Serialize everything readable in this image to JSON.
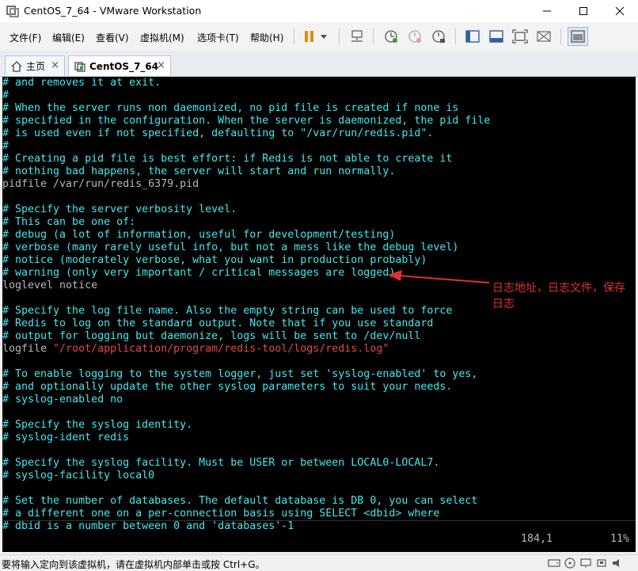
{
  "window": {
    "title": "CentOS_7_64 - VMware Workstation"
  },
  "menu": [
    "文件(F)",
    "编辑(E)",
    "查看(V)",
    "虚拟机(M)",
    "选项卡(T)",
    "帮助(H)"
  ],
  "tabs": {
    "home_label": "主页",
    "vm_label": "CentOS_7_64",
    "close_glyph": "×"
  },
  "terminal": {
    "lines": [
      {
        "t": "# and removes it at exit.",
        "c": "blue"
      },
      {
        "t": "#",
        "c": "blue"
      },
      {
        "t": "# When the server runs non daemonized, no pid file is created if none is",
        "c": "blue"
      },
      {
        "t": "# specified in the configuration. When the server is daemonized, the pid file",
        "c": "blue"
      },
      {
        "t": "# is used even if not specified, defaulting to \"/var/run/redis.pid\".",
        "c": "blue"
      },
      {
        "t": "#",
        "c": "blue"
      },
      {
        "t": "# Creating a pid file is best effort: if Redis is not able to create it",
        "c": "blue"
      },
      {
        "t": "# nothing bad happens, the server will start and run normally.",
        "c": "blue"
      },
      {
        "t": "pidfile /var/run/redis_6379.pid",
        "c": "gray"
      },
      {
        "t": "",
        "c": "gray"
      },
      {
        "t": "# Specify the server verbosity level.",
        "c": "blue"
      },
      {
        "t": "# This can be one of:",
        "c": "blue"
      },
      {
        "t": "# debug (a lot of information, useful for development/testing)",
        "c": "blue"
      },
      {
        "t": "# verbose (many rarely useful info, but not a mess like the debug level)",
        "c": "blue"
      },
      {
        "t": "# notice (moderately verbose, what you want in production probably)",
        "c": "blue"
      },
      {
        "t": "# warning (only very important / critical messages are logged)",
        "c": "blue"
      },
      {
        "t": "loglevel notice",
        "c": "gray"
      },
      {
        "t": "",
        "c": "gray"
      },
      {
        "t": "# Specify the log file name. Also the empty string can be used to force",
        "c": "blue"
      },
      {
        "t": "# Redis to log on the standard output. Note that if you use standard",
        "c": "blue"
      },
      {
        "t": "# output for logging but daemonize, logs will be sent to /dev/null",
        "c": "blue"
      },
      {
        "t": "logfile ",
        "c": "gray",
        "extra": "\"/root/application/program/redis-tool/logs/redis.log\"",
        "extra_c": "red"
      },
      {
        "t": "",
        "c": "gray"
      },
      {
        "t": "# To enable logging to the system logger, just set 'syslog-enabled' to yes,",
        "c": "blue"
      },
      {
        "t": "# and optionally update the other syslog parameters to suit your needs.",
        "c": "blue"
      },
      {
        "t": "# syslog-enabled no",
        "c": "blue"
      },
      {
        "t": "",
        "c": "gray"
      },
      {
        "t": "# Specify the syslog identity.",
        "c": "blue"
      },
      {
        "t": "# syslog-ident redis",
        "c": "blue"
      },
      {
        "t": "",
        "c": "gray"
      },
      {
        "t": "# Specify the syslog facility. Must be USER or between LOCAL0-LOCAL7.",
        "c": "blue"
      },
      {
        "t": "# syslog-facility local0",
        "c": "blue"
      },
      {
        "t": "",
        "c": "gray"
      },
      {
        "t": "# Set the number of databases. The default database is DB 0, you can select",
        "c": "blue"
      },
      {
        "t": "# a different one on a per-connection basis using SELECT <dbid> where",
        "c": "blue"
      },
      {
        "t": "# dbid is a number between 0 and 'databases'-1",
        "c": "blue"
      }
    ],
    "position": "184,1",
    "percent": "11%"
  },
  "annotation": {
    "text": "日志地址，日志文件，保存日志"
  },
  "statusbar": {
    "text": "要将输入定向到该虚拟机，请在虚拟机内部单击或按 Ctrl+G。"
  },
  "colors": {
    "terminal_bg": "#000000",
    "comment": "#44e8ee",
    "text": "#b8b8b8",
    "string": "#e04a4a",
    "annotation": "#e03030"
  }
}
